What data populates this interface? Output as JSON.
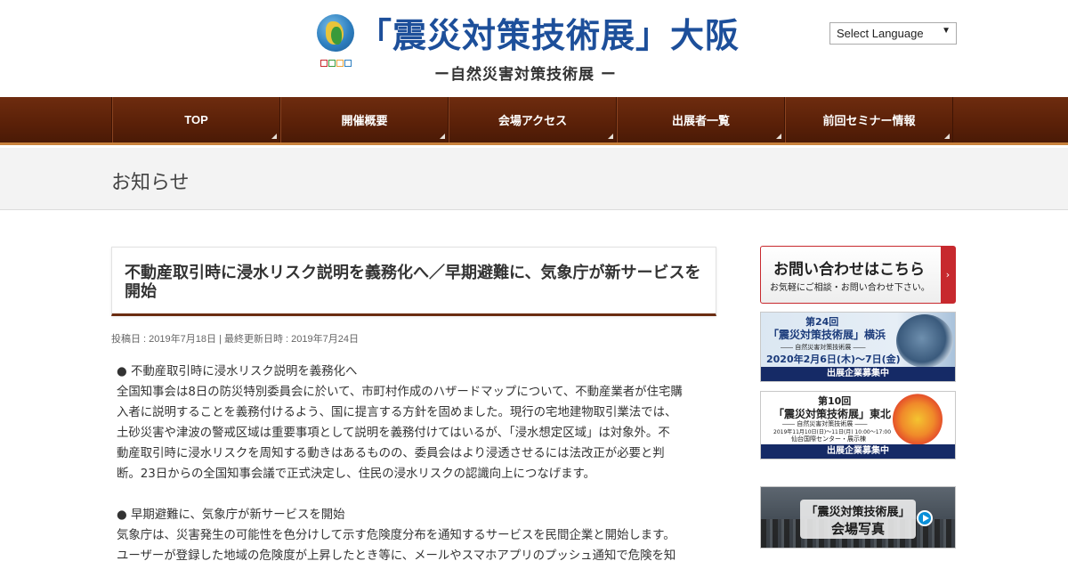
{
  "header": {
    "logo_title": "「震災対策技術展」大阪",
    "logo_subtitle": "ー自然災害対策技術展 ー",
    "language_select": "Select Language",
    "language_arrow": "▼"
  },
  "nav": {
    "items": [
      {
        "label": "TOP"
      },
      {
        "label": "開催概要"
      },
      {
        "label": "会場アクセス"
      },
      {
        "label": "出展者一覧"
      },
      {
        "label": "前回セミナー情報"
      }
    ]
  },
  "page": {
    "title": "お知らせ"
  },
  "article": {
    "title": "不動産取引時に浸水リスク説明を義務化へ／早期避難に、気象庁が新サービスを開始",
    "meta": "投稿日 : 2019年7月18日 | 最終更新日時 : 2019年7月24日",
    "sections": [
      {
        "heading": "● 不動産取引時に浸水リスク説明を義務化へ",
        "lines": [
          "全国知事会は8日の防災特別委員会に於いて、市町村作成のハザードマップについて、不動産業者が住宅購",
          "入者に説明することを義務付けるよう、国に提言する方針を固めました。現行の宅地建物取引業法では、",
          "土砂災害や津波の警戒区域は重要事項として説明を義務付けてはいるが、「浸水想定区域」は対象外。不",
          "動産取引時に浸水リスクを周知する動きはあるものの、委員会はより浸透させるには法改正が必要と判",
          "断。23日からの全国知事会議で正式決定し、住民の浸水リスクの認識向上につなげます。"
        ]
      },
      {
        "heading": "● 早期避難に、気象庁が新サービスを開始",
        "lines": [
          "気象庁は、災害発生の可能性を色分けして示す危険度分布を通知するサービスを民間企業と開始します。",
          "ユーザーが登録した地域の危険度が上昇したとき等に、メールやスマホアプリのプッシュ通知で危険を知"
        ]
      }
    ]
  },
  "sidebar": {
    "contact": {
      "title": "お問い合わせはこちら",
      "subtitle": "お気軽にご相談・お問い合わせ下さい。",
      "arrow": "›"
    },
    "banner_yokohama": {
      "edition": "第24回",
      "name": "「震災対策技術展」横浜",
      "sub": "―― 自然災害対策技術展 ――",
      "dates": "2020年2月6日(木)〜7日(金)",
      "strip": "出展企業募集中"
    },
    "banner_tohoku": {
      "edition": "第10回",
      "name": "「震災対策技術展」東北",
      "sub": "―― 自然災害対策技術展 ――",
      "dates": "2019年11月10日(日)〜11日(月) 10:00〜17:00",
      "venue": "仙台国際センター・展示棟",
      "strip": "出展企業募集中"
    },
    "banner_photos": {
      "line1": "「震災対策技術展」",
      "line2": "会場写真"
    }
  },
  "colors": {
    "nav_brown": "#5a2008",
    "nav_border": "#c9823d",
    "accent_red": "#c7292e",
    "logo_blue": "#1d4f9a"
  }
}
